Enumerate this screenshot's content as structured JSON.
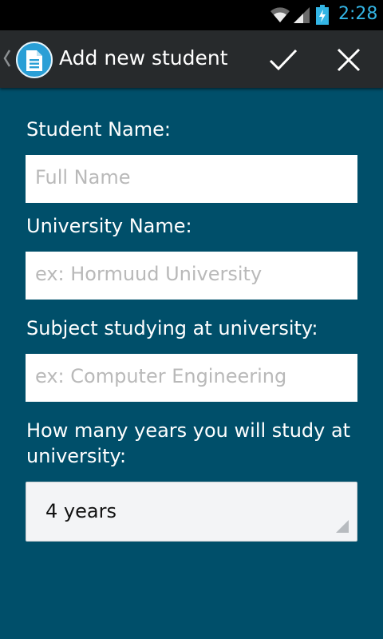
{
  "status_bar": {
    "time": "2:28"
  },
  "action_bar": {
    "title": "Add new student",
    "icons": {
      "app": "document-icon",
      "confirm": "checkmark-icon",
      "close": "close-icon",
      "up": "back-caret-icon"
    }
  },
  "form": {
    "student_name": {
      "label": "Student Name:",
      "placeholder": "Full Name"
    },
    "university_name": {
      "label": "University Name:",
      "placeholder": "ex: Hormuud University"
    },
    "subject": {
      "label": "Subject studying at university:",
      "placeholder": "ex: Computer Engineering"
    },
    "years": {
      "label_line1": "How many years you will study at",
      "label_line2": "university:",
      "selected": "4 years"
    }
  },
  "colors": {
    "background": "#004f6a",
    "action_bar": "#272a2c",
    "clock": "#33b5e5"
  }
}
